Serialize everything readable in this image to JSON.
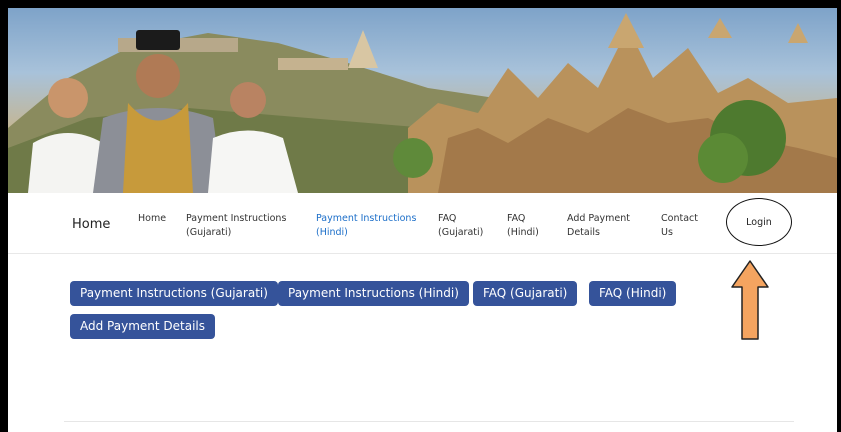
{
  "navbar": {
    "brand": "Home",
    "items": [
      {
        "label": "Home",
        "active": false
      },
      {
        "label": "Payment Instructions\n(Gujarati)",
        "active": false
      },
      {
        "label": "Payment Instructions\n(Hindi)",
        "active": true
      },
      {
        "label": "FAQ\n(Gujarati)",
        "active": false
      },
      {
        "label": "FAQ\n(Hindi)",
        "active": false
      },
      {
        "label": "Add Payment\nDetails",
        "active": false
      },
      {
        "label": "Contact\nUs",
        "active": false
      }
    ],
    "login": "Login"
  },
  "buttons": [
    {
      "label": "Payment Instructions (Gujarati)"
    },
    {
      "label": "Payment Instructions (Hindi)"
    },
    {
      "label": "FAQ (Gujarati)"
    },
    {
      "label": "FAQ (Hindi)"
    },
    {
      "label": "Add Payment Details"
    }
  ],
  "colors": {
    "primary": "#35539a",
    "nav_active": "#1d6fc9",
    "arrow_fill": "#f4a460",
    "arrow_stroke": "#222222"
  },
  "icons": {
    "arrow": "up-arrow-icon"
  }
}
